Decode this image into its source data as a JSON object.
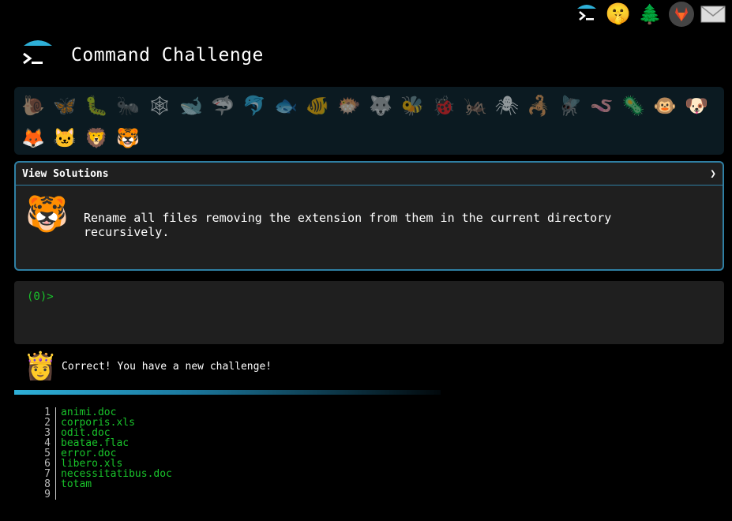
{
  "header": {
    "title": "Command Challenge"
  },
  "topbar": {
    "icons": [
      "terminal-icon",
      "shushing-face-icon",
      "evergreen-tree-icon",
      "gitlab-fox-icon",
      "mail-icon"
    ]
  },
  "animals": [
    "🐌",
    "🦋",
    "🐛",
    "🐜",
    "🕸",
    "🐋",
    "🦈",
    "🐬",
    "🐟",
    "🐠",
    "🐡",
    "🐺",
    "🐝",
    "🐞",
    "🦗",
    "🕷",
    "🦂",
    "🪰",
    "🪱",
    "🦠",
    "🐵",
    "🐶",
    "🦊",
    "🐱",
    "🦁",
    "🐯"
  ],
  "challenge": {
    "header_label": "View Solutions",
    "toggle_glyph": "❯",
    "avatar": "🐯",
    "text": "Rename all files removing the extension from them in the current directory recursively."
  },
  "terminal": {
    "prompt": "(0)>"
  },
  "message": {
    "avatar": "👸",
    "text": "Correct! You have a new challenge!",
    "progress": 0.6
  },
  "listing": {
    "lines": [
      {
        "n": "1",
        "name": "animi.doc"
      },
      {
        "n": "2",
        "name": "corporis.xls"
      },
      {
        "n": "3",
        "name": "odit.doc"
      },
      {
        "n": "4",
        "name": "beatae.flac"
      },
      {
        "n": "5",
        "name": "error.doc"
      },
      {
        "n": "6",
        "name": "libero.xls"
      },
      {
        "n": "7",
        "name": "necessitatibus.doc"
      },
      {
        "n": "8",
        "name": "totam"
      },
      {
        "n": "9",
        "name": ""
      }
    ]
  },
  "colors": {
    "accent": "#2f7fa3",
    "prompt_green": "#19c42b",
    "panel_bg": "#1f1f1f"
  }
}
